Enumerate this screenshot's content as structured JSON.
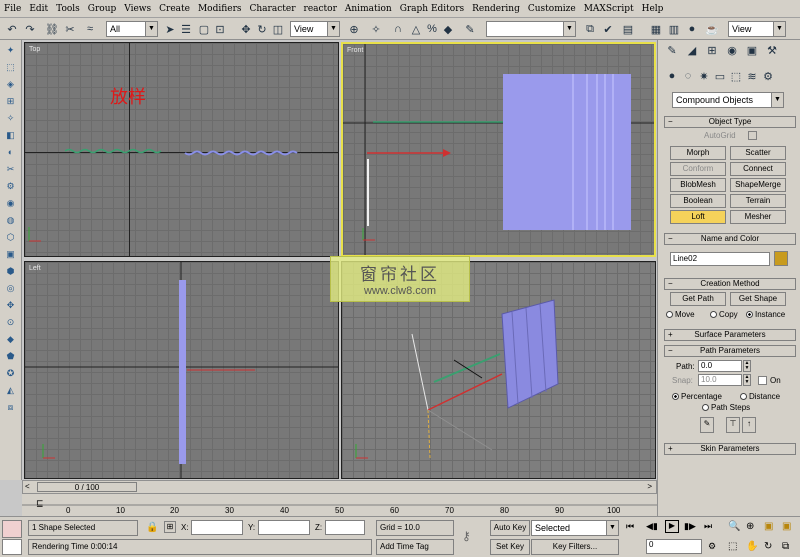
{
  "menu": [
    "File",
    "Edit",
    "Tools",
    "Group",
    "Views",
    "Create",
    "Modifiers",
    "Character",
    "reactor",
    "Animation",
    "Graph Editors",
    "Rendering",
    "Customize",
    "MAXScript",
    "Help"
  ],
  "toolbar": {
    "selection_filter": "All",
    "ref_coord": "View",
    "named_sel": "",
    "view_right": "View"
  },
  "viewports": {
    "top": "Top",
    "front": "Front",
    "left": "Left",
    "annotation": "放样"
  },
  "panel": {
    "category": "Compound Objects",
    "object_type": {
      "title": "Object Type",
      "autogrid": "AutoGrid",
      "buttons": [
        "Morph",
        "Scatter",
        "Conform",
        "Connect",
        "BlobMesh",
        "ShapeMerge",
        "Boolean",
        "Terrain",
        "Loft",
        "Mesher"
      ]
    },
    "name_color": {
      "title": "Name and Color",
      "name": "Line02",
      "color": "#c89b1e"
    },
    "creation": {
      "title": "Creation Method",
      "get_path": "Get Path",
      "get_shape": "Get Shape",
      "move": "Move",
      "copy": "Copy",
      "instance": "Instance"
    },
    "surface": {
      "title": "Surface Parameters"
    },
    "path": {
      "title": "Path Parameters",
      "path_label": "Path:",
      "path_value": "0.0",
      "snap_label": "Snap:",
      "snap_value": "10.0",
      "on": "On",
      "percentage": "Percentage",
      "distance": "Distance",
      "path_steps": "Path Steps"
    },
    "skin": {
      "title": "Skin Parameters"
    }
  },
  "timeline": {
    "frame": "0 / 100",
    "ticks": [
      "0",
      "10",
      "20",
      "30",
      "40",
      "50",
      "60",
      "70",
      "80",
      "90",
      "100"
    ]
  },
  "status": {
    "selected": "1 Shape Selected",
    "x_label": "X:",
    "y_label": "Y:",
    "z_label": "Z:",
    "grid": "Grid = 10.0",
    "render_time": "Rendering Time  0:00:14",
    "add_time_tag": "Add Time Tag",
    "auto_key": "Auto Key",
    "set_key": "Set Key",
    "key_mode": "Selected",
    "key_filters": "Key Filters...",
    "frame_field": "0"
  },
  "watermark": {
    "line1": "窗帘社区",
    "line2": "www.clw8.com"
  }
}
